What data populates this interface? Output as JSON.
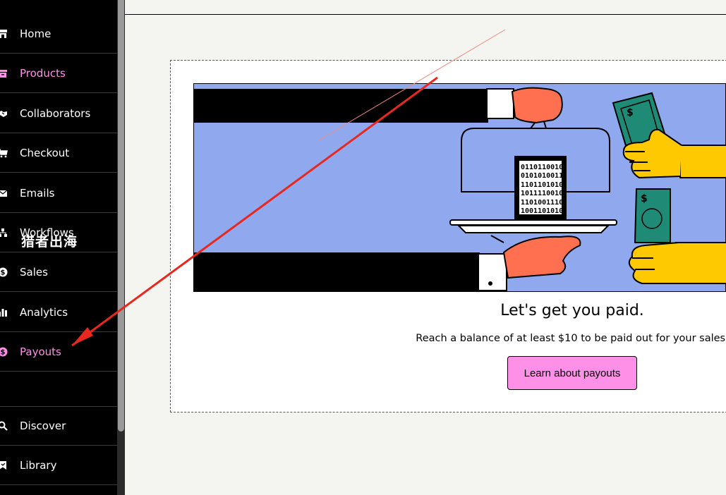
{
  "sidebar": {
    "items": [
      {
        "label": "Home",
        "icon": "store-icon"
      },
      {
        "label": "Products",
        "icon": "archive-icon",
        "active": true
      },
      {
        "label": "Collaborators",
        "icon": "handshake-icon"
      },
      {
        "label": "Checkout",
        "icon": "cart-icon"
      },
      {
        "label": "Emails",
        "icon": "envelope-icon"
      },
      {
        "label": "Workflows",
        "icon": "diagram-icon"
      },
      {
        "label": "Sales",
        "icon": "dollar-circle-icon"
      },
      {
        "label": "Analytics",
        "icon": "bar-chart-icon"
      },
      {
        "label": "Payouts",
        "icon": "dollar-circle-icon",
        "highlighted": true
      },
      {
        "label": "Discover",
        "icon": "search-icon"
      },
      {
        "label": "Library",
        "icon": "bookmark-icon"
      }
    ],
    "accent_color": "#ff90e8"
  },
  "watermark": "猎者出海",
  "empty_state": {
    "headline": "Let's get you paid.",
    "description": "Reach a balance of at least $10 to be paid out for your sales.",
    "button_label": "Learn about payouts",
    "illustration": "payout-illustration",
    "illustration_bg": "#90a8ed"
  },
  "annotation": {
    "type": "red-arrow",
    "color": "#e8281e",
    "target": "Payouts"
  }
}
